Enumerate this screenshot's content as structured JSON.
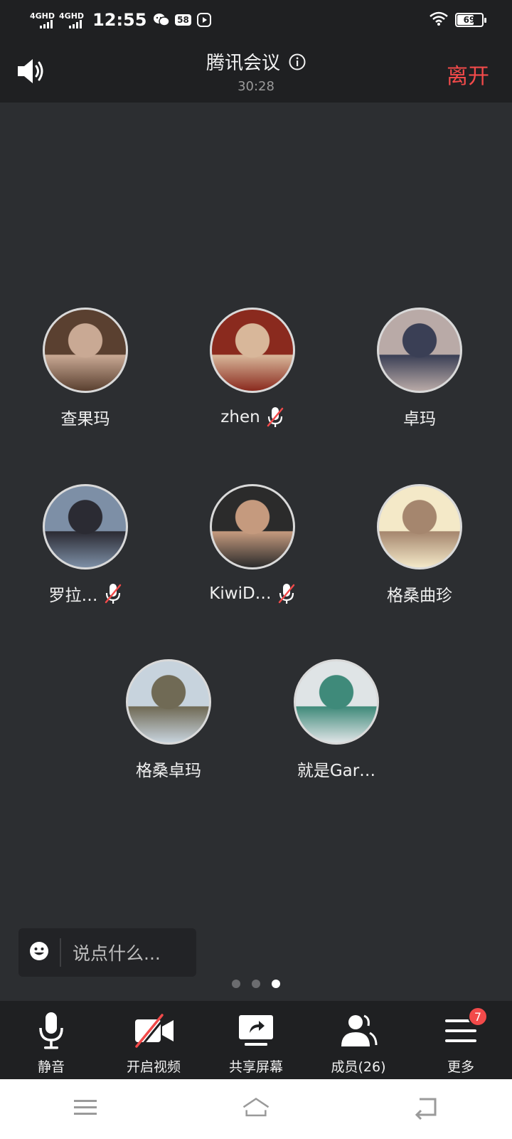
{
  "status_bar": {
    "signal1_label": "4GHD",
    "signal2_label": "4GHD",
    "time": "12:55",
    "notif_badge": "58",
    "battery": "69",
    "battery_level_percent": 69
  },
  "header": {
    "title": "腾讯会议",
    "timer": "30:28",
    "leave_label": "离开"
  },
  "participants": [
    {
      "name": "查果玛",
      "muted": false,
      "avatar_colors": [
        "#5a4030",
        "#c9a994"
      ]
    },
    {
      "name": "zhen",
      "muted": true,
      "avatar_colors": [
        "#8a2a1e",
        "#d8b79a"
      ]
    },
    {
      "name": "卓玛",
      "muted": false,
      "avatar_colors": [
        "#b9aaa7",
        "#3a3f55"
      ]
    },
    {
      "name": "罗拉…",
      "muted": true,
      "avatar_colors": [
        "#7d8fa6",
        "#2b2b33"
      ]
    },
    {
      "name": "KiwiD…",
      "muted": true,
      "avatar_colors": [
        "#2b2b2b",
        "#c59a7e"
      ]
    },
    {
      "name": "格桑曲珍",
      "muted": false,
      "avatar_colors": [
        "#f4e9c8",
        "#a5866e"
      ]
    },
    {
      "name": "格桑卓玛",
      "muted": false,
      "avatar_colors": [
        "#c7d3dd",
        "#706a55"
      ]
    },
    {
      "name": "就是Gar…",
      "muted": false,
      "avatar_colors": [
        "#dfe4e6",
        "#3f8a7a"
      ]
    }
  ],
  "chat": {
    "placeholder": "说点什么..."
  },
  "pager": {
    "count": 3,
    "active_index": 2
  },
  "toolbar": {
    "mute_label": "静音",
    "video_label": "开启视频",
    "share_label": "共享屏幕",
    "members_label": "成员(26)",
    "more_label": "更多",
    "more_badge": "7"
  },
  "colors": {
    "background": "#2c2e31",
    "bar": "#1f2022",
    "leave": "#f24a4a",
    "badge": "#f24a4a"
  }
}
